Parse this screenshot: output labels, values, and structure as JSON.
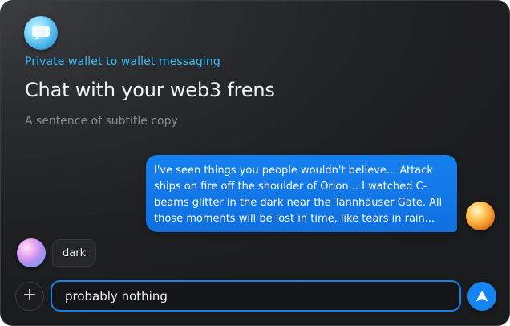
{
  "header": {
    "logo_icon": "chat-bubble-icon",
    "eyebrow": "Private wallet to wallet messaging",
    "title": "Chat with your web3 frens",
    "subtitle": "A sentence of subtitle copy"
  },
  "messages": [
    {
      "direction": "outgoing",
      "text": "I've seen things you people wouldn't believe... Attack ships on fire off the shoulder of Orion... I watched C-beams glitter in the dark near the Tannhäuser Gate. All those moments will be lost in time, like tears in rain..."
    },
    {
      "direction": "incoming",
      "text": "dark"
    }
  ],
  "composer": {
    "add_icon": "plus-icon",
    "value": "probably nothing",
    "send_icon": "send-arrow-icon"
  },
  "colors": {
    "accent": "#1684f0",
    "eyebrow": "#38bdf8",
    "background": "#1f2022"
  }
}
